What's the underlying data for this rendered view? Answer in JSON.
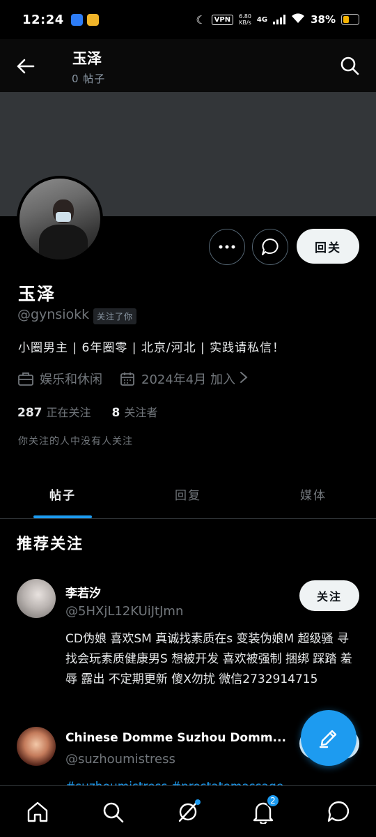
{
  "status_bar": {
    "time": "12:24",
    "vpn": "VPN",
    "speed_value": "6.80",
    "speed_unit": "KB/s",
    "network": "4G",
    "battery": "38%"
  },
  "header": {
    "title": "玉泽",
    "post_count": "0 帖子"
  },
  "profile": {
    "name": "玉泽",
    "handle": "@gynsiokk",
    "follows_you": "关注了你",
    "bio": "小圈男主 | 6年圈零 | 北京/河北 | 实践请私信！",
    "category": "娱乐和休闲",
    "joined": "2024年4月 加入",
    "following_count": "287",
    "following_label": "正在关注",
    "followers_count": "8",
    "followers_label": "关注者",
    "mutual_text": "你关注的人中没有人关注",
    "followback_label": "回关"
  },
  "tabs": [
    {
      "label": "帖子",
      "active": true
    },
    {
      "label": "回复",
      "active": false
    },
    {
      "label": "媒体",
      "active": false
    }
  ],
  "recommended": {
    "title": "推荐关注",
    "items": [
      {
        "name": "李若汐",
        "handle": "@5HXjL12KUiJtJmn",
        "follow_label": "关注",
        "bio": "CD伪娘 喜欢SM 真诚找素质在s 变装伪娘M 超级骚 寻找会玩素质健康男S 想被开发 喜欢被强制 捆绑 踩踏 羞辱 露出 不定期更新 傻X勿扰 微信2732914715"
      },
      {
        "name": "Chinese Domme Suzhou Domm...",
        "handle": "@suzhoumistress",
        "follow_label": "关注",
        "bio": "#suzhoumistress #prostatemassage"
      }
    ]
  },
  "bottom_nav": {
    "notifications_badge": "2"
  },
  "colors": {
    "accent": "#1d9bf0",
    "background": "#000000",
    "muted": "#71767b",
    "banner": "#333639"
  }
}
